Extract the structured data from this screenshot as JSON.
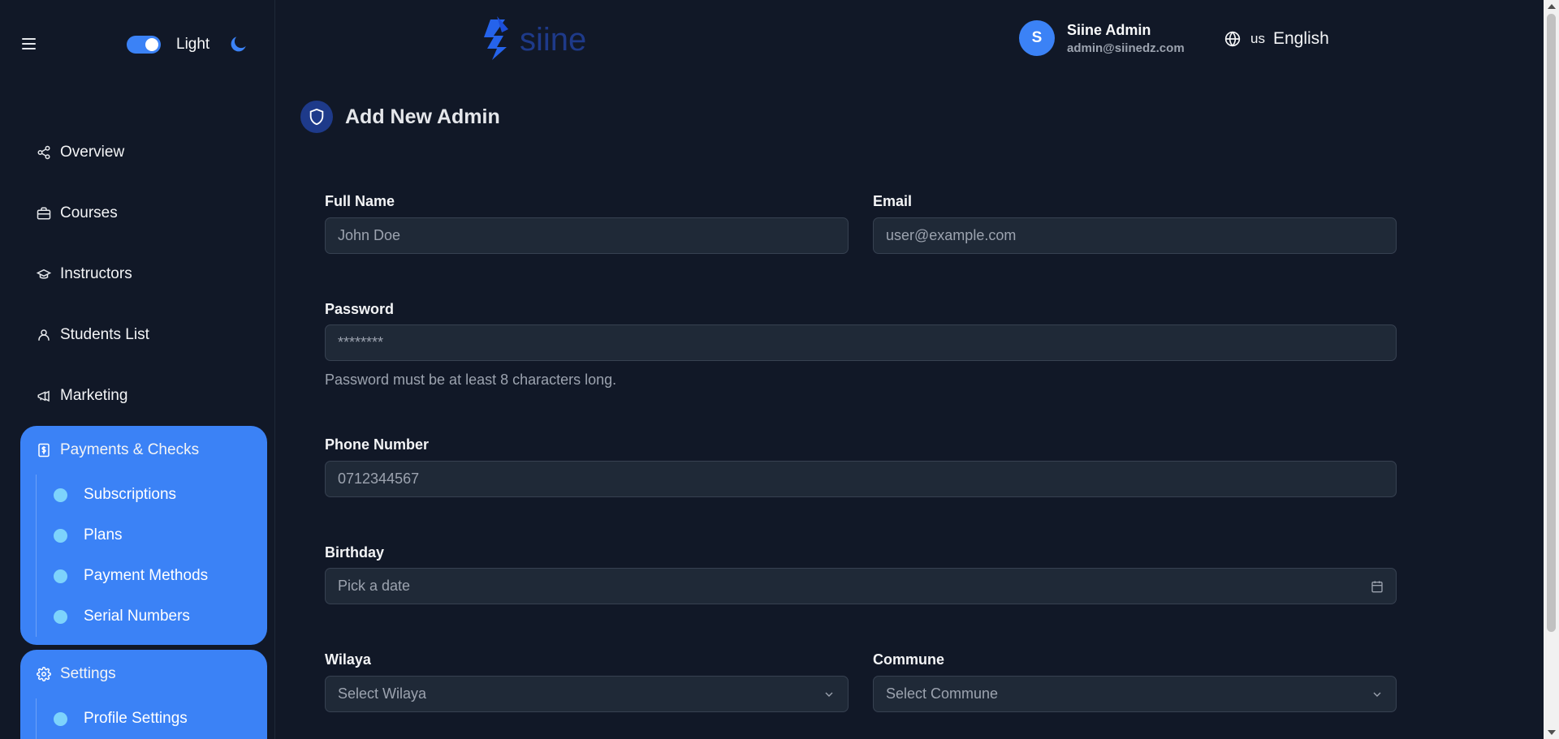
{
  "sidebar": {
    "theme_label": "Light",
    "nav": [
      {
        "label": "Overview",
        "icon": "share-icon"
      },
      {
        "label": "Courses",
        "icon": "briefcase-icon"
      },
      {
        "label": "Instructors",
        "icon": "graduation-cap-icon"
      },
      {
        "label": "Students List",
        "icon": "user-icon"
      },
      {
        "label": "Marketing",
        "icon": "megaphone-icon"
      }
    ],
    "payments": {
      "label": "Payments & Checks",
      "icon": "receipt-dollar-icon",
      "items": [
        "Subscriptions",
        "Plans",
        "Payment Methods",
        "Serial Numbers"
      ]
    },
    "settings": {
      "label": "Settings",
      "icon": "gear-icon",
      "items": [
        "Profile Settings"
      ]
    }
  },
  "header": {
    "logo_text": "siine",
    "user": {
      "initial": "S",
      "name": "Siine Admin",
      "email": "admin@siinedz.com"
    },
    "language": {
      "code": "us",
      "name": "English"
    }
  },
  "page": {
    "title": "Add New Admin"
  },
  "form": {
    "full_name": {
      "label": "Full Name",
      "placeholder": "John Doe"
    },
    "email": {
      "label": "Email",
      "placeholder": "user@example.com"
    },
    "password": {
      "label": "Password",
      "placeholder": "********",
      "hint": "Password must be at least 8 characters long."
    },
    "phone": {
      "label": "Phone Number",
      "placeholder": "0712344567"
    },
    "birthday": {
      "label": "Birthday",
      "placeholder": "Pick a date"
    },
    "wilaya": {
      "label": "Wilaya",
      "placeholder": "Select Wilaya"
    },
    "commune": {
      "label": "Commune",
      "placeholder": "Select Commune"
    }
  },
  "colors": {
    "accent": "#3b82f6",
    "background": "#111827",
    "input_bg": "#1f2937"
  }
}
